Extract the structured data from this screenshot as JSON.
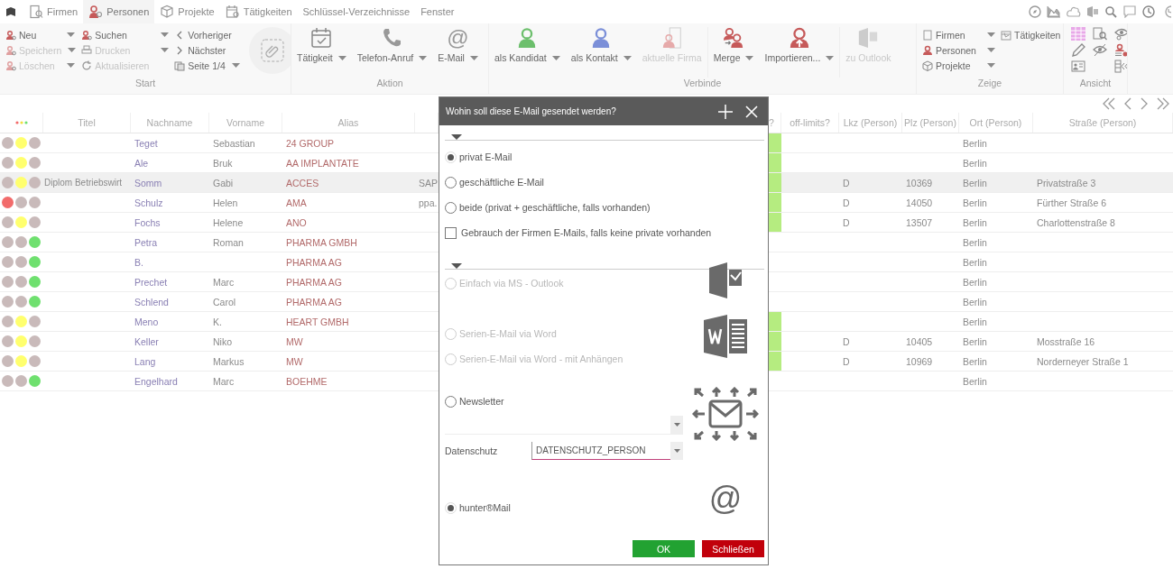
{
  "menu": {
    "items": [
      {
        "label": "Firmen",
        "selected": false
      },
      {
        "label": "Personen",
        "selected": true
      },
      {
        "label": "Projekte",
        "selected": false
      },
      {
        "label": "Tätigkeiten",
        "selected": false
      },
      {
        "label": "Schlüssel-Verzeichnisse",
        "selected": false
      },
      {
        "label": "Fenster",
        "selected": false
      }
    ]
  },
  "ribbon": {
    "groups": [
      {
        "title": "Start",
        "columns": [
          [
            {
              "label": "Neu",
              "disabled": false,
              "dropdown": true
            },
            {
              "label": "Speichern",
              "disabled": true,
              "dropdown": true
            },
            {
              "label": "Löschen",
              "disabled": true,
              "dropdown": true
            }
          ],
          [
            {
              "label": "Suchen",
              "disabled": false,
              "dropdown": true
            },
            {
              "label": "Drucken",
              "disabled": true,
              "dropdown": true
            },
            {
              "label": "Aktualisieren",
              "disabled": true,
              "dropdown": false
            }
          ],
          [
            {
              "label": "Vorheriger",
              "disabled": false,
              "dropdown": false
            },
            {
              "label": "Nächster",
              "disabled": false,
              "dropdown": false
            },
            {
              "label": "Seite 1/4",
              "disabled": false,
              "dropdown": true
            }
          ]
        ]
      },
      {
        "title": "Aktion",
        "buttons": [
          {
            "label": "Tätigkeit",
            "disabled": false,
            "dropdown": true
          },
          {
            "label": "Telefon-Anruf",
            "disabled": false,
            "dropdown": true
          },
          {
            "label": "E-Mail",
            "disabled": false,
            "dropdown": true,
            "glyph": "@"
          }
        ]
      },
      {
        "title": "Verbinde",
        "buttons": [
          {
            "label": "als Kandidat",
            "disabled": false,
            "dropdown": true,
            "color": "#6cbf6c"
          },
          {
            "label": "als Kontakt",
            "disabled": false,
            "dropdown": true,
            "color": "#7b8fd8"
          },
          {
            "label": "aktuelle Firma",
            "disabled": true,
            "dropdown": false
          },
          {
            "label": "Merge",
            "disabled": false,
            "dropdown": true
          },
          {
            "label": "Importieren...",
            "disabled": false,
            "dropdown": true
          },
          {
            "label": "zu Outlook",
            "disabled": true,
            "dropdown": false
          }
        ]
      },
      {
        "title": "Zeige",
        "columns": [
          [
            {
              "label": "Firmen",
              "disabled": false,
              "dropdown": true
            },
            {
              "label": "Personen",
              "disabled": false,
              "dropdown": true
            },
            {
              "label": "Projekte",
              "disabled": false,
              "dropdown": true
            }
          ],
          [
            {
              "label": "Tätigkeiten",
              "disabled": false,
              "dropdown": false
            }
          ]
        ]
      },
      {
        "title": "Ansicht"
      }
    ]
  },
  "table": {
    "columns": [
      "Titel",
      "Nachname",
      "Vorname",
      "Alias",
      "?",
      "off-limits?",
      "Lkz (Person)",
      "Plz (Person)",
      "Ort (Person)",
      "Straße (Person)"
    ],
    "rows": [
      {
        "status": [
          {
            "color": "#c9baba"
          },
          {
            "color": "#ffff6e"
          },
          {
            "color": "#c9baba"
          }
        ],
        "nachname": "Teget",
        "vorname": "Sebastian",
        "alias": "24 GROUP",
        "flag": true,
        "ort": "Berlin",
        "selected": false
      },
      {
        "status": [
          {
            "color": "#c9baba"
          },
          {
            "color": "#ffff6e"
          },
          {
            "color": "#c9baba"
          }
        ],
        "nachname": "Ale",
        "vorname": "Bruk",
        "alias": "AA IMPLANTATE",
        "flag": true,
        "ort": "Berlin",
        "selected": false
      },
      {
        "status": [
          {
            "color": "#c9baba"
          },
          {
            "color": "#ffff6e"
          },
          {
            "color": "#c9baba"
          }
        ],
        "titel": "Diplom Betriebswirt",
        "nachname": "Somm",
        "vorname": "Gabi",
        "alias": "ACCES",
        "column_6": "SAP",
        "flag": true,
        "lkz": "D",
        "plz": "10369",
        "ort": "Berlin",
        "strasse": "Privatstraße 3",
        "selected": true
      },
      {
        "status": [
          {
            "color": "#f26b6b"
          },
          {
            "color": "#c9baba"
          },
          {
            "color": "#c9baba"
          }
        ],
        "nachname": "Schulz",
        "vorname": "Helen",
        "alias": "AMA",
        "column_6": "ppa.",
        "flag": true,
        "lkz": "D",
        "plz": "14050",
        "ort": "Berlin",
        "strasse": "Fürther Straße 6",
        "selected": false
      },
      {
        "status": [
          {
            "color": "#c9baba"
          },
          {
            "color": "#ffff6e"
          },
          {
            "color": "#c9baba"
          }
        ],
        "nachname": "Fochs",
        "vorname": "Helene",
        "alias": "ANO",
        "flag": true,
        "lkz": "D",
        "plz": "13507",
        "ort": "Berlin",
        "strasse": "Charlottenstraße 8",
        "selected": false
      },
      {
        "status": [
          {
            "color": "#c9baba"
          },
          {
            "color": "#c9baba"
          },
          {
            "color": "#6fe06f"
          }
        ],
        "nachname": "Petra",
        "vorname": "Roman",
        "alias": "PHARMA GMBH",
        "flag": false,
        "ort": "Berlin",
        "selected": false
      },
      {
        "status": [
          {
            "color": "#c9baba"
          },
          {
            "color": "#c9baba"
          },
          {
            "color": "#6fe06f"
          }
        ],
        "nachname": "B.",
        "alias": "PHARMA AG",
        "flag": false,
        "ort": "Berlin",
        "selected": false
      },
      {
        "status": [
          {
            "color": "#c9baba"
          },
          {
            "color": "#c9baba"
          },
          {
            "color": "#6fe06f"
          }
        ],
        "nachname": "Prechet",
        "vorname": "Marc",
        "alias": "PHARMA AG",
        "flag": false,
        "ort": "Berlin",
        "selected": false
      },
      {
        "status": [
          {
            "color": "#c9baba"
          },
          {
            "color": "#c9baba"
          },
          {
            "color": "#6fe06f"
          }
        ],
        "nachname": "Schlend",
        "vorname": "Carol",
        "alias": "PHARMA AG",
        "flag": false,
        "ort": "Berlin",
        "selected": false
      },
      {
        "status": [
          {
            "color": "#c9baba"
          },
          {
            "color": "#ffff6e"
          },
          {
            "color": "#c9baba"
          }
        ],
        "nachname": "Meno",
        "vorname": "K.",
        "alias": "HEART GMBH",
        "flag": true,
        "ort": "Berlin",
        "selected": false
      },
      {
        "status": [
          {
            "color": "#c9baba"
          },
          {
            "color": "#ffff6e"
          },
          {
            "color": "#c9baba"
          }
        ],
        "nachname": "Keller",
        "vorname": "Niko",
        "alias": "MW",
        "flag": true,
        "lkz": "D",
        "plz": "10405",
        "ort": "Berlin",
        "strasse": "Mosstraße 16",
        "selected": false
      },
      {
        "status": [
          {
            "color": "#c9baba"
          },
          {
            "color": "#ffff6e"
          },
          {
            "color": "#c9baba"
          }
        ],
        "nachname": "Lang",
        "vorname": "Markus",
        "alias": "MW",
        "flag": true,
        "lkz": "D",
        "plz": "10969",
        "ort": "Berlin",
        "strasse": "Norderneyer Straße 1",
        "selected": false
      },
      {
        "status": [
          {
            "color": "#c9baba"
          },
          {
            "color": "#c9baba"
          },
          {
            "color": "#6fe06f"
          }
        ],
        "nachname": "Engelhard",
        "vorname": "Marc",
        "alias": "BOEHME",
        "flag": false,
        "ort": "Berlin",
        "selected": false
      }
    ]
  },
  "dialog": {
    "title": "Wohin soll diese E-Mail gesendet werden?",
    "recipients": [
      {
        "label": "privat E-Mail",
        "selected": true
      },
      {
        "label": "geschäftliche E-Mail",
        "selected": false
      },
      {
        "label": "beide (privat + geschäftliche, falls vorhanden)",
        "selected": false
      }
    ],
    "company_fallback": {
      "label": "Gebrauch der Firmen E-Mails, falls keine private vorhanden",
      "checked": false
    },
    "methods": [
      {
        "label": "Einfach via MS - Outlook",
        "selected": false,
        "disabled": true
      },
      {
        "label": "Serien-E-Mail via Word",
        "selected": false,
        "disabled": true
      },
      {
        "label": "Serien-E-Mail via Word - mit Anhängen",
        "selected": false,
        "disabled": true
      },
      {
        "label": "Newsletter",
        "selected": false,
        "disabled": false
      },
      {
        "label": "hunter®Mail",
        "selected": true,
        "disabled": false
      }
    ],
    "datenschutz": {
      "label": "Datenschutz",
      "value": "DATENSCHUTZ_PERSON"
    },
    "at_glyph": "@",
    "buttons": [
      {
        "label": "OK",
        "kind": "ok"
      },
      {
        "label": "Schließen",
        "kind": "close"
      }
    ]
  }
}
